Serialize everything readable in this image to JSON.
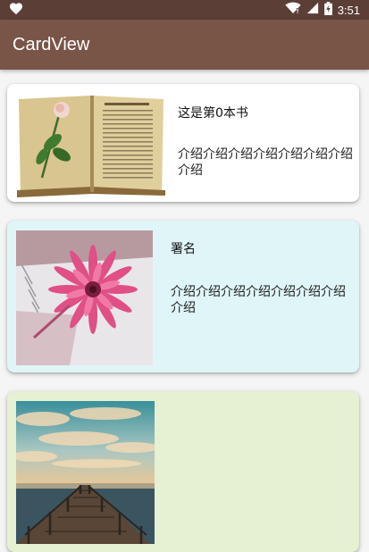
{
  "status_bar": {
    "time": "3:51",
    "icons": [
      "heart-icon",
      "wifi-icon",
      "cell-signal-icon",
      "battery-icon"
    ]
  },
  "app_bar": {
    "title": "CardView"
  },
  "cards": [
    {
      "title": "这是第0本书",
      "description": "介绍介绍介绍介绍介绍介绍介绍介绍",
      "image": "open-book-with-rose",
      "background": "#ffffff"
    },
    {
      "title": "署名",
      "description": "介绍介绍介绍介绍介绍介绍介绍介绍",
      "image": "pink-gerbera-on-notebook",
      "background": "#e0f5f8"
    },
    {
      "title": "",
      "description": "",
      "image": "wooden-pier-at-sunset",
      "background": "#e6f0d2"
    }
  ],
  "colors": {
    "status_bar": "#5b3f36",
    "app_bar": "#795548",
    "page_background": "#f5f5f5"
  }
}
